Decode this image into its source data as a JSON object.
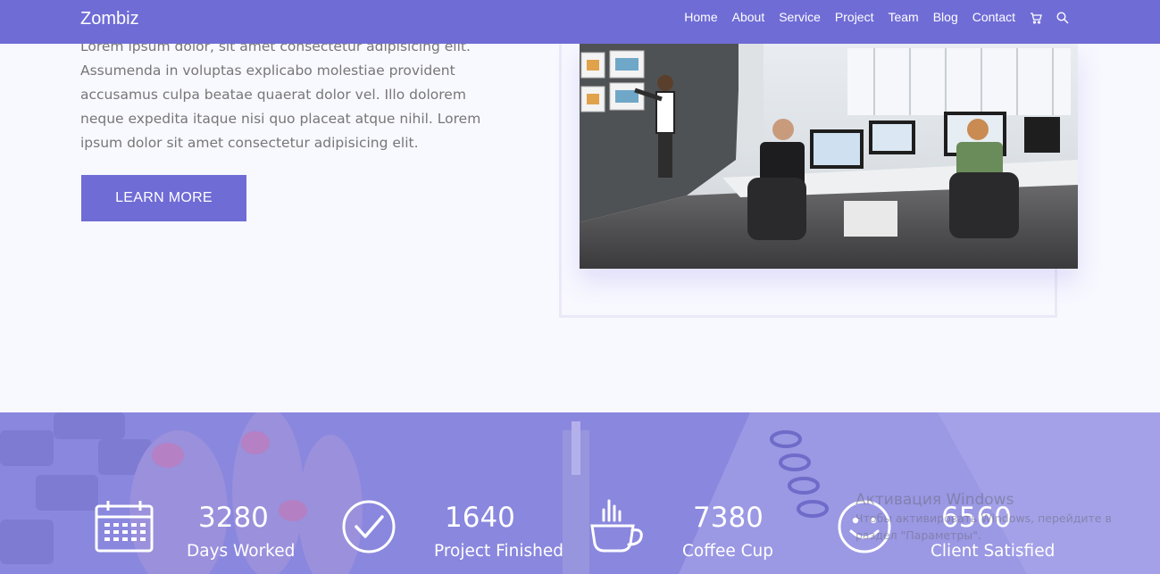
{
  "brand": "Zombiz",
  "nav": {
    "items": [
      "Home",
      "About",
      "Service",
      "Project",
      "Team",
      "Blog",
      "Contact"
    ],
    "icons": [
      "cart-icon",
      "search-icon"
    ]
  },
  "hero": {
    "paragraph": "Lorem ipsum dolor, sit amet consectetur adipisicing elit. Assumenda in voluptas explicabo molestiae provident accusamus culpa beatae quaerat dolor vel. Illo dolorem neque expedita itaque nisi quo placeat atque nihil. Lorem ipsum dolor sit amet consectetur adipisicing elit.",
    "button": "LEARN MORE"
  },
  "stats": [
    {
      "icon": "calendar-icon",
      "value": "3280",
      "label": "Days Worked"
    },
    {
      "icon": "check-circle-icon",
      "value": "1640",
      "label": "Project Finished"
    },
    {
      "icon": "coffee-cup-icon",
      "value": "7380",
      "label": "Coffee Cup"
    },
    {
      "icon": "smiley-icon",
      "value": "6560",
      "label": "Client Satisfied"
    }
  ],
  "watermark": {
    "title": "Активация Windows",
    "line1": "Чтобы активировать Windows, перейдите в",
    "line2": "раздел \"Параметры\"."
  },
  "colors": {
    "accent": "#6f6cd6",
    "stats_bg": "#8784dc"
  }
}
